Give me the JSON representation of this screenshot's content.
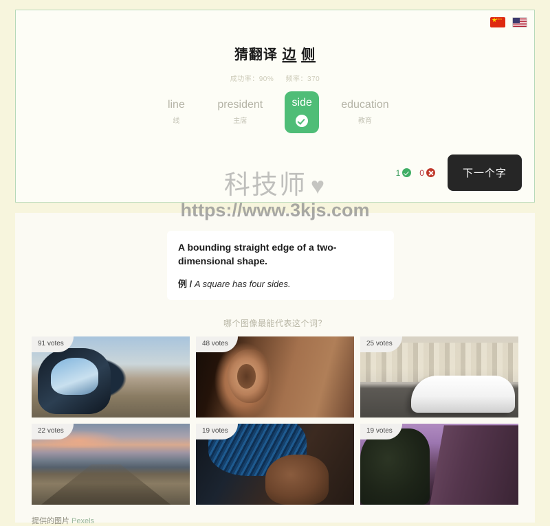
{
  "header": {
    "flags": [
      {
        "name": "flag-china",
        "label": "中文"
      },
      {
        "name": "flag-usa",
        "label": "English"
      }
    ]
  },
  "quiz": {
    "title_prefix": "猜翻译",
    "word_zh_1": "边",
    "word_zh_2": "侧",
    "stats": {
      "success_rate": "成功率：90%",
      "frequency": "频率：370"
    },
    "options": [
      {
        "en": "line",
        "zh": "线",
        "correct": false
      },
      {
        "en": "president",
        "zh": "主席",
        "correct": false
      },
      {
        "en": "side",
        "zh": "",
        "correct": true
      },
      {
        "en": "education",
        "zh": "教育",
        "correct": false
      }
    ],
    "score": {
      "correct_count": "1",
      "wrong_count": "0"
    },
    "next_button": "下一个字"
  },
  "watermark": {
    "line1": "科技师",
    "heart": "♥",
    "line2": "https://www.3kjs.com"
  },
  "definition": {
    "text": "A bounding straight edge of a two-dimensional shape.",
    "example_label": "例 /",
    "example_text": "A square has four sides."
  },
  "images": {
    "question": "哪个图像最能代表这个词？",
    "tiles": [
      {
        "votes": "91 votes",
        "art": "art-mirror",
        "alt": "car side mirror on highway"
      },
      {
        "votes": "48 votes",
        "art": "art-ear",
        "alt": "close up of an ear, side of face"
      },
      {
        "votes": "25 votes",
        "art": "art-car",
        "alt": "white car side profile with city skyline"
      },
      {
        "votes": "22 votes",
        "art": "art-road",
        "alt": "country road at sunset"
      },
      {
        "votes": "19 votes",
        "art": "art-hat",
        "alt": "person in blue knit hat, side profile"
      },
      {
        "votes": "19 votes",
        "art": "art-building",
        "alt": "side of building at dusk"
      }
    ],
    "credit_text": "提供的图片",
    "credit_link": "Pexels"
  },
  "colors": {
    "page_bg": "#f7f5dd",
    "card_bg": "#fdfdf6",
    "card_border": "#b7d9b9",
    "accent_green": "#4fbd77",
    "correct_green": "#3fae64",
    "wrong_red": "#c0392b",
    "button_dark": "#262626"
  }
}
